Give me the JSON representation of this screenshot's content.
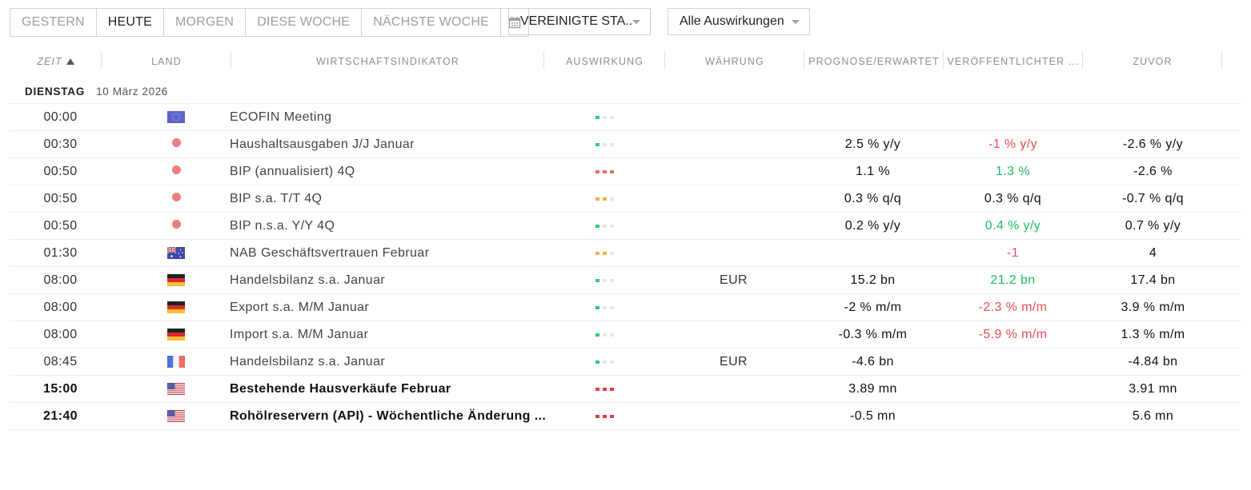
{
  "toolbar": {
    "buttons": [
      "GESTERN",
      "HEUTE",
      "MORGEN",
      "DIESE WOCHE",
      "NÄCHSTE WOCHE"
    ],
    "active_index": 1,
    "calendar_icon": "calendar-icon"
  },
  "filters": {
    "country": "VEREINIGTE STA...",
    "impact": "Alle Auswirkungen"
  },
  "columns": {
    "time": "ZEIT",
    "country": "LAND",
    "indicator": "WIRTSCHAFTSINDIKATOR",
    "impact": "AUSWIRKUNG",
    "currency": "WÄHRUNG",
    "forecast": "PROGNOSE/ERWARTET",
    "actual": "VERÖFFENTLICHTER ...",
    "previous": "ZUVOR"
  },
  "day": {
    "name": "DIENSTAG",
    "date": "10 März 2026"
  },
  "colors": {
    "positive": "#1fbf63",
    "negative": "#ef4d56",
    "impact_high": "#ee3b44",
    "impact_medium": "#f4b04c",
    "impact_low": "#2ecc71"
  },
  "events": [
    {
      "time": "00:00",
      "flag": "eu-flag-icon",
      "name": "ECOFIN Meeting",
      "impact": "low",
      "currency": "",
      "forecast": "",
      "actual": "",
      "actual_tone": "neu",
      "previous": ""
    },
    {
      "time": "00:30",
      "flag": "red-dot-icon",
      "name": "Haushaltsausgaben J/J Januar",
      "impact": "low",
      "currency": "",
      "forecast": "2.5 % y/y",
      "actual": "-1 % y/y",
      "actual_tone": "neg",
      "previous": "-2.6 % y/y"
    },
    {
      "time": "00:50",
      "flag": "red-dot-icon",
      "name": "BIP (annualisiert) 4Q",
      "impact": "hi-soft",
      "currency": "",
      "forecast": "1.1 %",
      "actual": "1.3 %",
      "actual_tone": "pos",
      "previous": "-2.6 %"
    },
    {
      "time": "00:50",
      "flag": "red-dot-icon",
      "name": "BIP s.a. T/T 4Q",
      "impact": "med",
      "currency": "",
      "forecast": "0.3 % q/q",
      "actual": "0.3 % q/q",
      "actual_tone": "neu",
      "previous": "-0.7 % q/q"
    },
    {
      "time": "00:50",
      "flag": "red-dot-icon",
      "name": "BIP n.s.a. Y/Y 4Q",
      "impact": "low",
      "currency": "",
      "forecast": "0.2 % y/y",
      "actual": "0.4 % y/y",
      "actual_tone": "pos",
      "previous": "0.7 % y/y"
    },
    {
      "time": "01:30",
      "flag": "au-flag-icon",
      "name": "NAB Geschäftsvertrauen Februar",
      "impact": "med",
      "currency": "",
      "forecast": "",
      "actual": "-1",
      "actual_tone": "neg",
      "previous": "4"
    },
    {
      "time": "08:00",
      "flag": "de-flag-icon",
      "name": "Handelsbilanz s.a. Januar",
      "impact": "low",
      "currency": "EUR",
      "forecast": "15.2 bn",
      "actual": "21.2 bn",
      "actual_tone": "pos",
      "previous": "17.4 bn"
    },
    {
      "time": "08:00",
      "flag": "de-flag-icon",
      "name": "Export s.a. M/M Januar",
      "impact": "low",
      "currency": "",
      "forecast": "-2 % m/m",
      "actual": "-2.3 % m/m",
      "actual_tone": "neg",
      "previous": "3.9 % m/m"
    },
    {
      "time": "08:00",
      "flag": "de-flag-icon",
      "name": "Import s.a. M/M Januar",
      "impact": "low",
      "currency": "",
      "forecast": "-0.3 % m/m",
      "actual": "-5.9 % m/m",
      "actual_tone": "neg",
      "previous": "1.3 % m/m"
    },
    {
      "time": "08:45",
      "flag": "fr-flag-icon",
      "name": "Handelsbilanz s.a. Januar",
      "impact": "low",
      "currency": "EUR",
      "forecast": "-4.6 bn",
      "actual": "",
      "actual_tone": "neu",
      "previous": "-4.84 bn"
    },
    {
      "time": "15:00",
      "flag": "us-flag-icon",
      "name": "Bestehende Hausverkäufe Februar",
      "impact": "high",
      "currency": "",
      "forecast": "3.89 mn",
      "actual": "",
      "actual_tone": "neu",
      "previous": "3.91 mn",
      "bold": true
    },
    {
      "time": "21:40",
      "flag": "us-flag-icon",
      "name": "Rohölreservern (API) - Wöchentliche Änderung ...",
      "impact": "high",
      "currency": "",
      "forecast": "-0.5 mn",
      "actual": "",
      "actual_tone": "neu",
      "previous": "5.6 mn",
      "bold": true
    }
  ]
}
